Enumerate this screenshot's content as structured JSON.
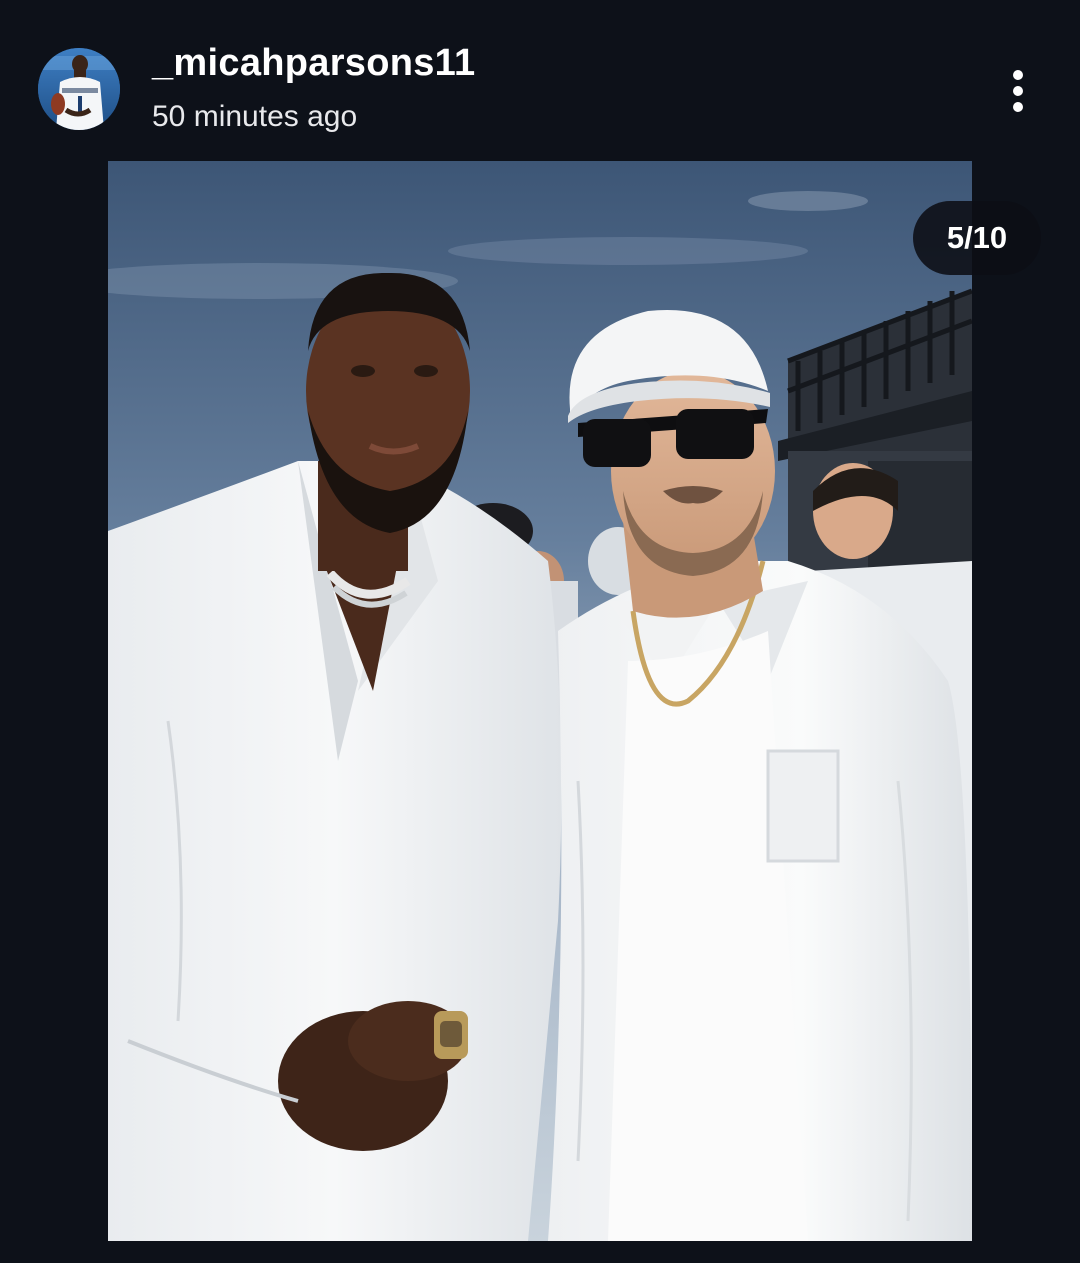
{
  "post": {
    "username": "_micahparsons11",
    "timestamp": "50 minutes ago",
    "image_counter": "5/10"
  },
  "icons": {
    "more": "vertical-ellipsis-icon",
    "avatar": "profile-photo"
  },
  "colors": {
    "background": "#0d1119",
    "text": "#ffffff",
    "counter_pill": "#0c0e14"
  }
}
